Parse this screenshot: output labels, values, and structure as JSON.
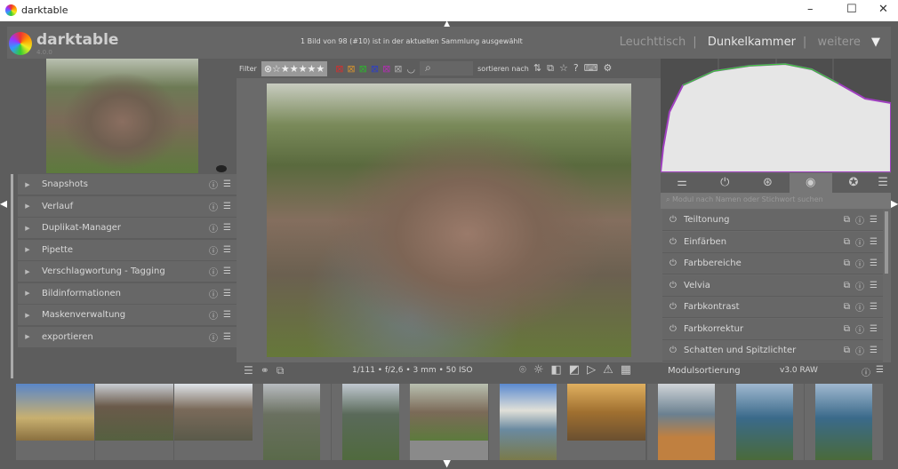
{
  "window": {
    "title": "darktable",
    "controls": [
      "–",
      "☐",
      "✕"
    ]
  },
  "header": {
    "app_name": "darktable",
    "version": "4.0.0",
    "status": "1 Bild von 98 (#10) ist in der aktuellen Sammlung ausgewählt",
    "views": [
      "Leuchttisch",
      "Dunkelkammer",
      "weitere"
    ],
    "active_view": "Dunkelkammer"
  },
  "toolbar": {
    "filter_label": "Filter",
    "rating": "⊗☆★★★★★",
    "color_labels": [
      "#d03030",
      "#d09030",
      "#30b030",
      "#3040c0",
      "#b030b0",
      "#aaaaaa"
    ],
    "sort_label": "sortieren nach"
  },
  "left_modules": [
    "Snapshots",
    "Verlauf",
    "Duplikat-Manager",
    "Pipette",
    "Verschlagwortung - Tagging",
    "Bildinformationen",
    "Maskenverwaltung",
    "exportieren"
  ],
  "image_info": "1/111 • f/2,6 • 3 mm • 50 ISO",
  "right": {
    "search_placeholder": "Modul nach Namen oder Stichwort suchen",
    "modules": [
      "Teiltonung",
      "Einfärben",
      "Farbbereiche",
      "Velvia",
      "Farbkontrast",
      "Farbkorrektur",
      "Schatten und Spitzlichter"
    ],
    "module_order_label": "Modulsortierung",
    "module_order_value": "v3.0 RAW"
  },
  "filmstrip": {
    "count": 11,
    "selected_index": 5
  }
}
